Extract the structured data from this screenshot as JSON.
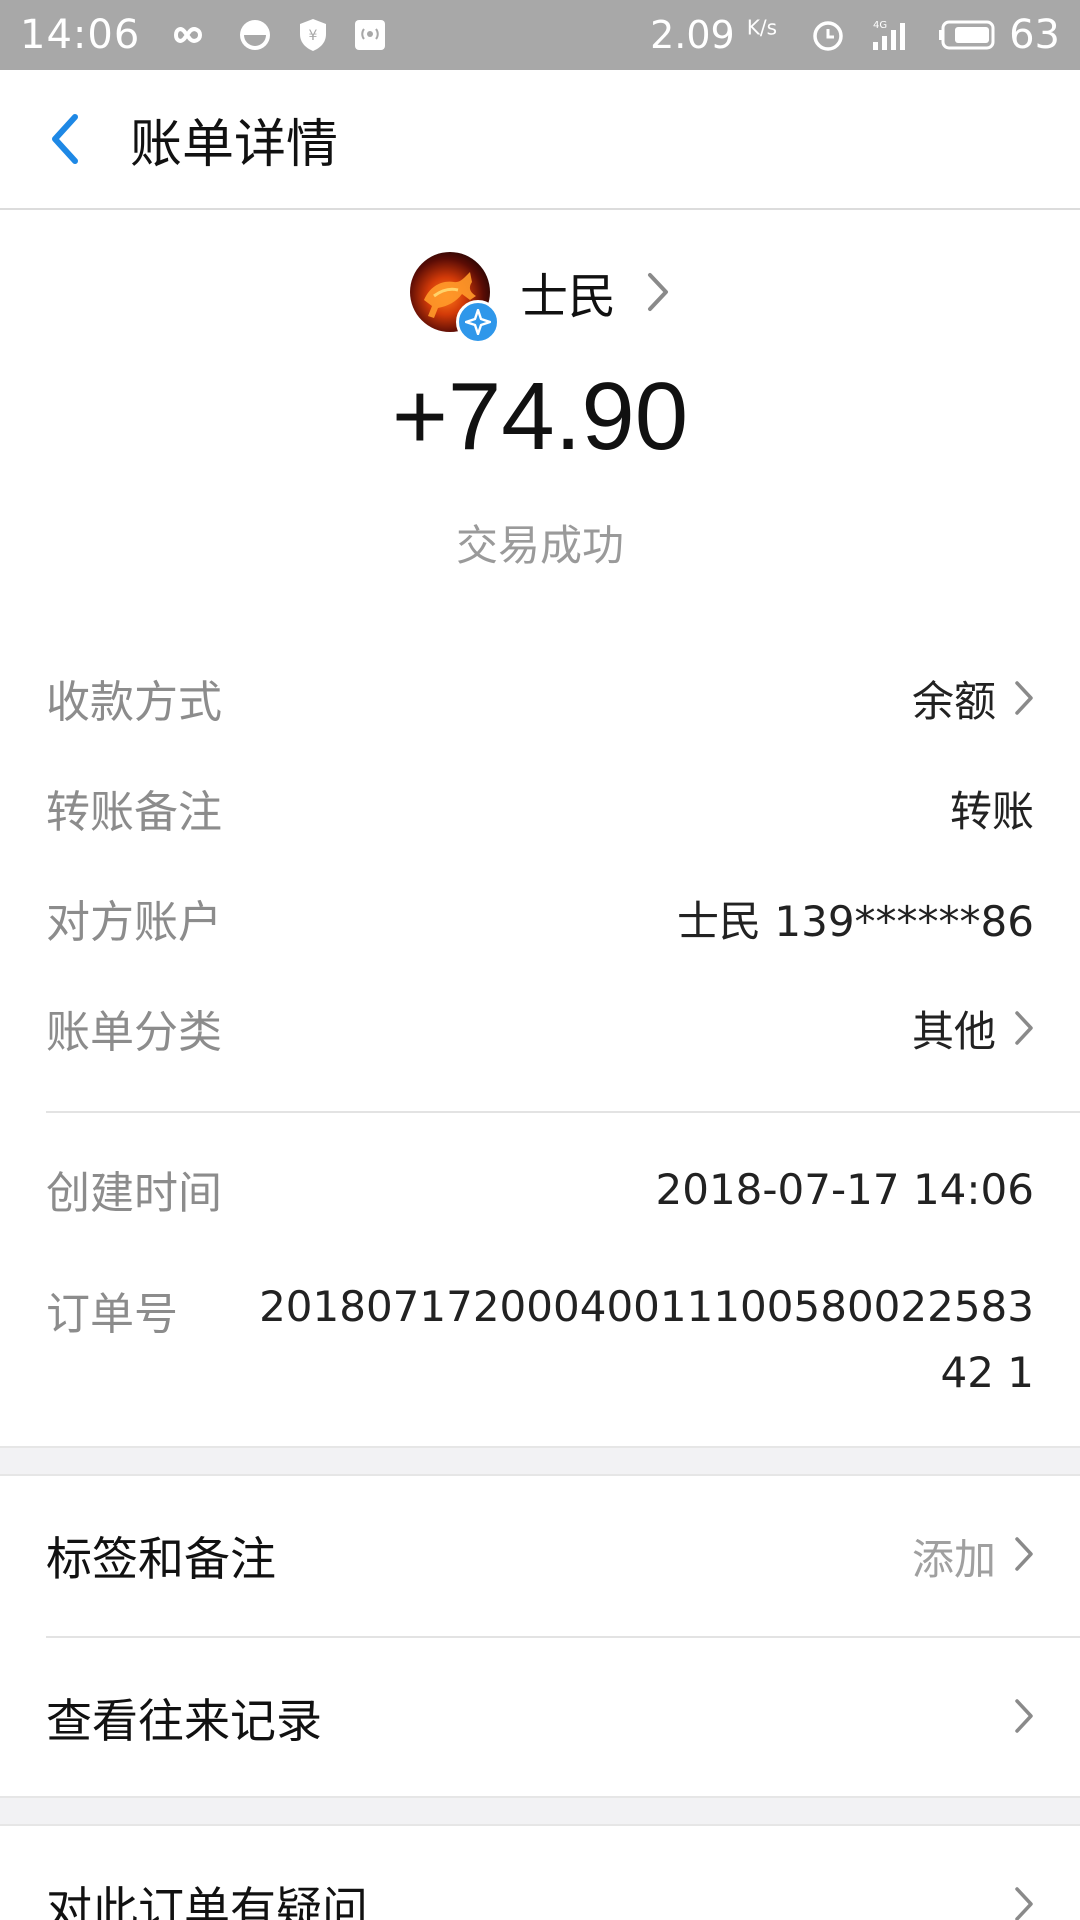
{
  "status_bar": {
    "time": "14:06",
    "speed": "2.09",
    "speed_unit": "K/s",
    "battery": "63",
    "icons": [
      "infinity-icon",
      "face-icon",
      "shield-yen-icon",
      "hotspot-icon",
      "alarm-icon",
      "signal-4g-icon",
      "battery-icon"
    ]
  },
  "nav": {
    "title": "账单详情",
    "back_icon": "chevron-left-icon"
  },
  "header": {
    "payer_name": "士民",
    "amount": "+74.90",
    "status": "交易成功"
  },
  "details": {
    "rows": [
      {
        "label": "收款方式",
        "value": "余额",
        "has_chevron": true
      },
      {
        "label": "转账备注",
        "value": "转账",
        "has_chevron": false
      },
      {
        "label": "对方账户",
        "value": "士民 139******86",
        "has_chevron": false
      },
      {
        "label": "账单分类",
        "value": "其他",
        "has_chevron": true
      }
    ],
    "created_label": "创建时间",
    "created_value": "2018-07-17 14:06",
    "order_label": "订单号",
    "order_value": "2018071720004001110058002258342 1"
  },
  "actions": {
    "tags_label": "标签和备注",
    "tags_hint": "添加",
    "history_label": "查看往来记录",
    "question_label": "对此订单有疑问"
  },
  "colors": {
    "accent": "#2f97ea",
    "status_bar_bg": "#a8a8a8",
    "label_gray": "#8c8c8c",
    "section_gap": "#f2f2f4"
  }
}
